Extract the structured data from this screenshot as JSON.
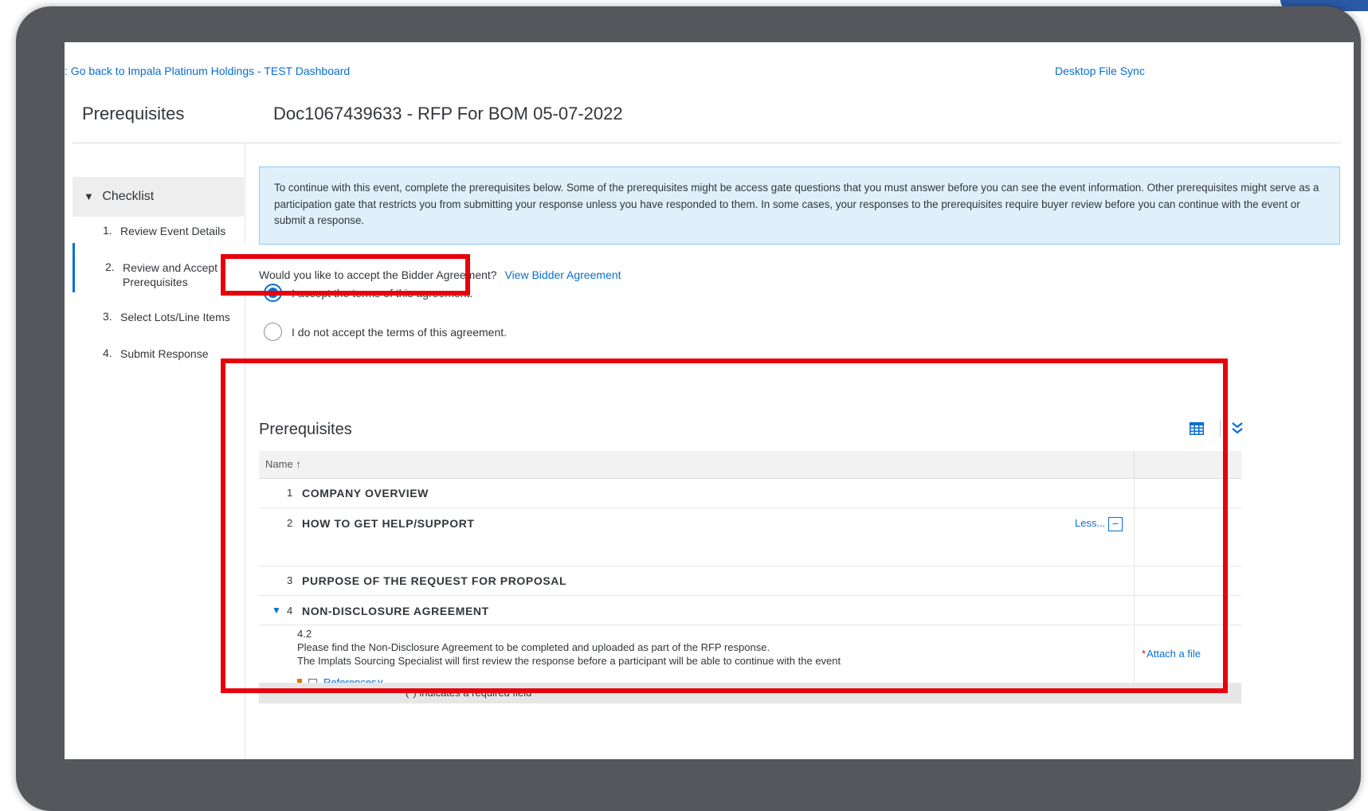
{
  "nav": {
    "back_link": ": Go back to Impala Platinum Holdings - TEST Dashboard",
    "desktop_sync": "Desktop File Sync"
  },
  "header": {
    "page_title": "Prerequisites",
    "doc_title": "Doc1067439633 - RFP For BOM 05-07-2022"
  },
  "checklist": {
    "title": "Checklist",
    "caret": "▼",
    "steps": [
      {
        "num": "1.",
        "label": "Review Event Details"
      },
      {
        "num": "2.",
        "label": "Review and Accept Prerequisites"
      },
      {
        "num": "3.",
        "label": "Select Lots/Line Items"
      },
      {
        "num": "4.",
        "label": "Submit Response"
      }
    ]
  },
  "info": {
    "text": "To continue with this event, complete the prerequisites below.  Some of the prerequisites might be access gate questions that you must answer before you can see the event information.  Other prerequisites might serve as a participation gate that restricts you from submitting your response unless you have responded to them.  In some cases, your responses to the prerequisites require buyer review before you can continue with the event or submit a response."
  },
  "agreement": {
    "question": "Would you like to accept the Bidder Agreement?",
    "view_link": "View Bidder Agreement",
    "accept_label": "I accept the terms of this agreement.",
    "decline_label": "I do not accept the terms of this agreement.",
    "selected": "accept"
  },
  "prereq_table": {
    "title": "Prerequisites",
    "col_name": "Name",
    "sort_arrow": "↑",
    "rows": [
      {
        "num": "1",
        "title": "COMPANY OVERVIEW"
      },
      {
        "num": "2",
        "title": "HOW TO GET HELP/SUPPORT",
        "less": "Less...",
        "minus": "−"
      },
      {
        "num": "3",
        "title": "PURPOSE OF THE REQUEST FOR PROPOSAL"
      },
      {
        "num": "4",
        "title": "NON-DISCLOSURE AGREEMENT",
        "caret": "▼"
      }
    ],
    "detail": {
      "num": "4.2",
      "line1": "Please find the Non-Disclosure Agreement to be completed and uploaded as part of the RFP response.",
      "line2": "The Implats Sourcing Specialist will first review the response before a participant will be able to  continue with the event",
      "required_mark": "*",
      "attach": "Attach a file",
      "references": "References∨"
    },
    "footer_note": "(*) indicates a required field"
  },
  "colors": {
    "accent": "#0a6ed1",
    "highlight": "#e8000c",
    "frame": "#55575c",
    "info_bg": "#dff0fb"
  }
}
